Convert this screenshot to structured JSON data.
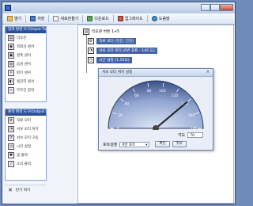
{
  "toolbar": {
    "items": [
      {
        "label": "열기",
        "icon": "folder-icon"
      },
      {
        "label": "저장",
        "icon": "save-icon"
      },
      {
        "label": "새로만들기",
        "icon": "new-icon"
      },
      {
        "label": "다운로드",
        "icon": "download-icon"
      },
      {
        "label": "업그레이드",
        "icon": "upgrade-icon"
      },
      {
        "label": "도움말",
        "icon": "help-icon"
      }
    ]
  },
  "input_panel": {
    "title": "입력 명령 도구(Input Tool)",
    "items": [
      "리모콘",
      "적외선 센서",
      "접촉 센서",
      "음성 센서",
      "밝기 센서",
      "빛감지 센서",
      "무조건 참적"
    ]
  },
  "output_panel": {
    "title": "출력 명령 도구(Output Tool)",
    "items": [
      "직류 모터",
      "서보 모터 위치",
      "서보 모터 구동",
      "시간 설정",
      "빛 출력",
      "소리 출력"
    ]
  },
  "close_label": "닫기 위기",
  "tree": {
    "root": "리모콘 버튼 1+5",
    "children": [
      "직류 모터 (전진, 전진)",
      "서보 모터 위치 (0번 포트 - 140 도)",
      "시간 설정 (1.50초)"
    ]
  },
  "dialog": {
    "title": "서보 모터 위치 설정",
    "close_label": "×",
    "gauge": {
      "min": 0,
      "max": 180,
      "value": 140,
      "ticks": [
        "0",
        "20",
        "40",
        "60",
        "80",
        "100",
        "120",
        "140",
        "160",
        "180"
      ]
    },
    "angle_label": "각도",
    "angle_value": "70",
    "port_label": "포트설정",
    "port_value": "0번 포트",
    "ok_label": "확인",
    "cancel_label": "취소"
  }
}
